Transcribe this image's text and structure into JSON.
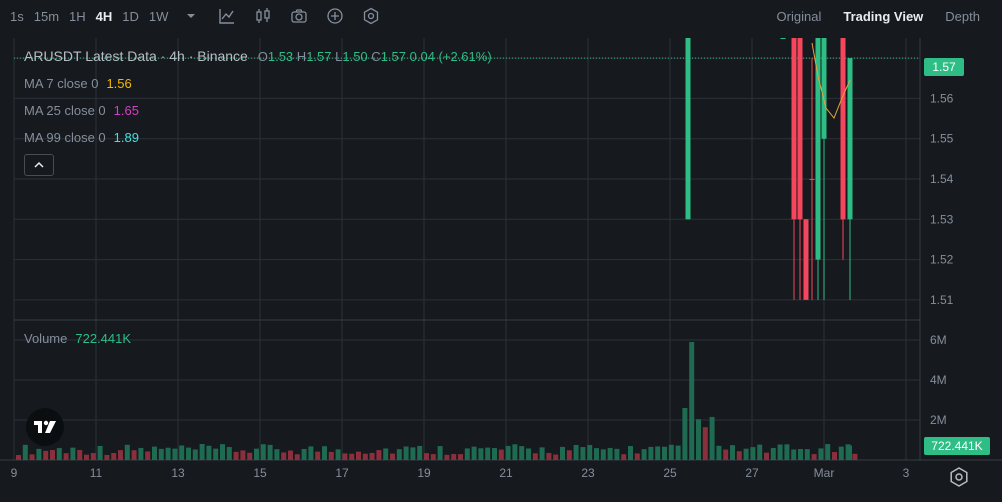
{
  "toolbar": {
    "intervals": [
      {
        "label": "1s",
        "active": false
      },
      {
        "label": "15m",
        "active": false
      },
      {
        "label": "1H",
        "active": false
      },
      {
        "label": "4H",
        "active": true
      },
      {
        "label": "1D",
        "active": false
      },
      {
        "label": "1W",
        "active": false
      }
    ],
    "icons": [
      "chevron-down-icon",
      "line-chart-icon",
      "candles-icon",
      "camera-icon",
      "add-indicator-icon",
      "settings-hex-icon"
    ],
    "views": [
      {
        "label": "Original",
        "active": false
      },
      {
        "label": "Trading View",
        "active": true
      },
      {
        "label": "Depth",
        "active": false
      }
    ]
  },
  "legend": {
    "title": "ARUSDT Latest Data · 4h · Binance",
    "open_label": "O",
    "open": "1.53",
    "high_label": "H",
    "high": "1.57",
    "low_label": "L",
    "low": "1.50",
    "close_label": "C",
    "close": "1.57",
    "change": "0.04 (+2.61%)"
  },
  "ma": [
    {
      "label": "MA 7 close 0",
      "value": "1.56",
      "color": "#f0b90b"
    },
    {
      "label": "MA 25 close 0",
      "value": "1.65",
      "color": "#d63cc8"
    },
    {
      "label": "MA 99 close 0",
      "value": "1.89",
      "color": "#3de2e6"
    }
  ],
  "volume": {
    "label": "Volume",
    "value": "722.441K"
  },
  "price_tag": "1.57",
  "volume_tag": "722.441K",
  "colors": {
    "up": "#2ebd85",
    "down": "#f6465d",
    "grid": "#2b3139",
    "bg": "#161a1e"
  },
  "chart_data": {
    "type": "candlestick",
    "symbol": "ARUSDT",
    "interval": "4h",
    "price_axis": {
      "ticks": [
        "1.57",
        "1.56",
        "1.55",
        "1.54",
        "1.53",
        "1.52",
        "1.51"
      ],
      "range": [
        1.505,
        1.575
      ]
    },
    "volume_axis": {
      "ticks": [
        "6M",
        "4M",
        "2M"
      ],
      "range": [
        0,
        7000000
      ]
    },
    "x_ticks": [
      "9",
      "11",
      "13",
      "15",
      "17",
      "19",
      "21",
      "23",
      "25",
      "27",
      "Mar",
      "3"
    ],
    "candles": [
      {
        "o": 1.53,
        "h": 1.58,
        "l": 1.53,
        "c": 1.58,
        "up": true
      },
      {
        "o": 1.58,
        "h": 1.58,
        "l": 1.58,
        "c": 1.58,
        "up": true
      },
      {
        "o": 1.58,
        "h": 1.58,
        "l": 1.51,
        "c": 1.53,
        "up": false
      },
      {
        "o": 1.58,
        "h": 1.58,
        "l": 1.51,
        "c": 1.53,
        "up": false
      },
      {
        "o": 1.53,
        "h": 1.53,
        "l": 1.51,
        "c": 1.51,
        "up": false
      },
      {
        "o": 1.54,
        "h": 1.57,
        "l": 1.51,
        "c": 1.54,
        "up": false
      },
      {
        "o": 1.52,
        "h": 1.58,
        "l": 1.51,
        "c": 1.58,
        "up": true
      },
      {
        "o": 1.55,
        "h": 1.58,
        "l": 1.51,
        "c": 1.58,
        "up": true
      },
      {
        "o": 1.58,
        "h": 1.58,
        "l": 1.52,
        "c": 1.53,
        "up": false
      },
      {
        "o": 1.53,
        "h": 1.57,
        "l": 1.51,
        "c": 1.57,
        "up": true
      }
    ],
    "volume_last": 722441
  }
}
